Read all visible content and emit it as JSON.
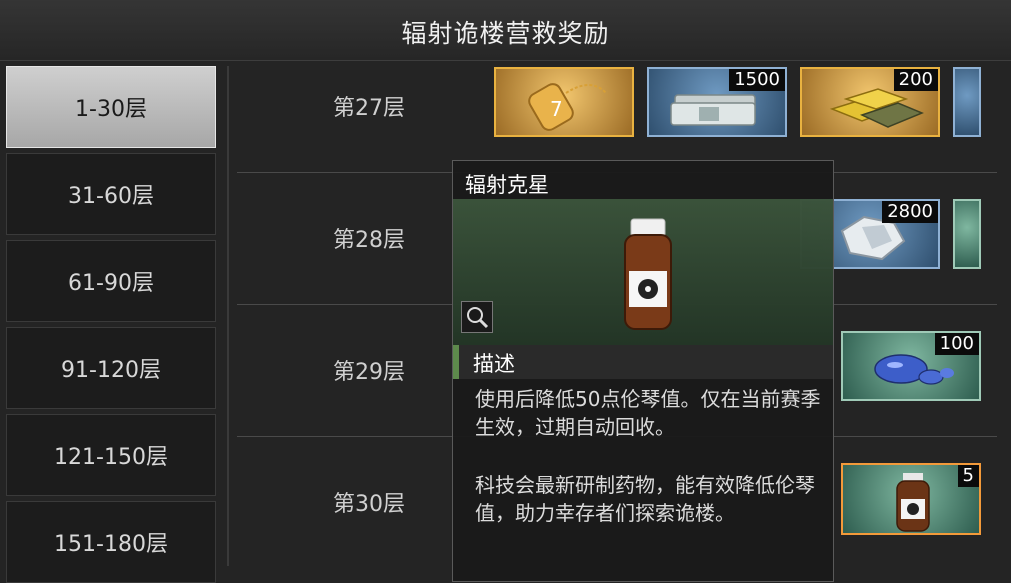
{
  "header": {
    "title": "辐射诡楼营救奖励"
  },
  "tabs": [
    {
      "label": "1-30层",
      "active": true
    },
    {
      "label": "31-60层",
      "active": false
    },
    {
      "label": "61-90层",
      "active": false
    },
    {
      "label": "91-120层",
      "active": false
    },
    {
      "label": "121-150层",
      "active": false
    },
    {
      "label": "151-180层",
      "active": false
    }
  ],
  "rows": [
    {
      "floor": "第27层",
      "items": [
        {
          "icon": "dog-tag-icon",
          "count": ""
        },
        {
          "icon": "cash-stack-icon",
          "count": "1500"
        },
        {
          "icon": "gold-bars-icon",
          "count": "200"
        }
      ]
    },
    {
      "floor": "第28层",
      "items": [
        {
          "icon": "crystal-icon",
          "count": "2800"
        }
      ]
    },
    {
      "floor": "第29层",
      "items": [
        {
          "icon": "blue-gel-icon",
          "count": "100"
        }
      ]
    },
    {
      "floor": "第30层",
      "items": [
        {
          "icon": "radiation-bottle-icon",
          "count": "5"
        }
      ]
    }
  ],
  "tooltip": {
    "name": "辐射克星",
    "section": "描述",
    "desc1": "使用后降低50点伦琴值。仅在当前赛季生效，过期自动回收。",
    "desc2": "科技会最新研制药物，能有效降低伦琴值，助力幸存者们探索诡楼。",
    "icon": "magnifier-icon"
  },
  "colors": {
    "gold": "#e9b240",
    "selected": "#f39a3a",
    "accent": "#5d8a4c"
  }
}
